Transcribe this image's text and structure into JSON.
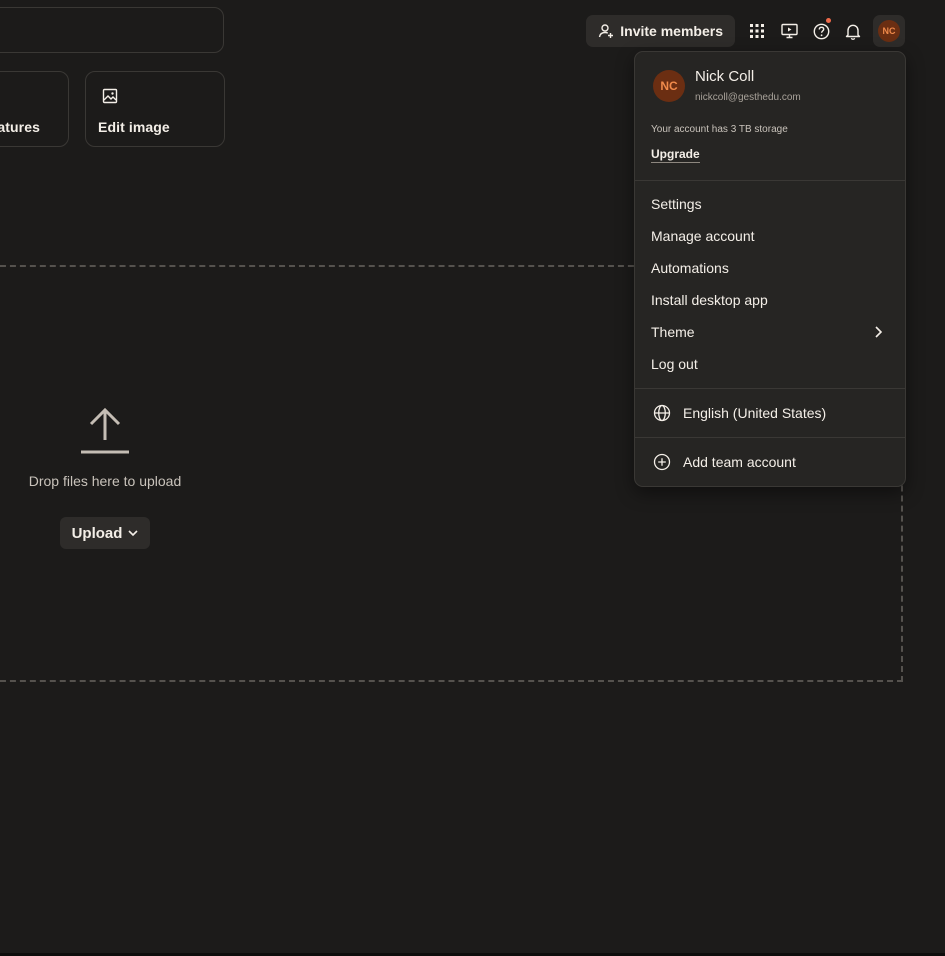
{
  "header": {
    "invite_label": "Invite members",
    "avatar_initials": "NC",
    "icons": [
      "user-plus-icon",
      "grid-icon",
      "monitor-icon",
      "help-icon",
      "bell-icon"
    ],
    "notification_dot_color": "#ef6a4a"
  },
  "actions": {
    "features_label": "atures",
    "edit_image_label": "Edit image"
  },
  "dropzone": {
    "text": "Drop files here to upload",
    "upload_label": "Upload"
  },
  "account_menu": {
    "avatar_initials": "NC",
    "name": "Nick Coll",
    "email": "nickcoll@gesthedu.com",
    "storage_text": "Your account has 3 TB storage",
    "upgrade_label": "Upgrade",
    "items": [
      {
        "label": "Settings"
      },
      {
        "label": "Manage account"
      },
      {
        "label": "Automations"
      },
      {
        "label": "Install desktop app"
      },
      {
        "label": "Theme"
      },
      {
        "label": "Log out"
      }
    ],
    "language_label": "English (United States)",
    "add_team_label": "Add team account"
  },
  "colors": {
    "background": "#1c1b1a",
    "surface": "#262523",
    "button": "#2e2c2a",
    "avatar_bg": "#6b2e12",
    "avatar_text": "#f08a4b"
  }
}
